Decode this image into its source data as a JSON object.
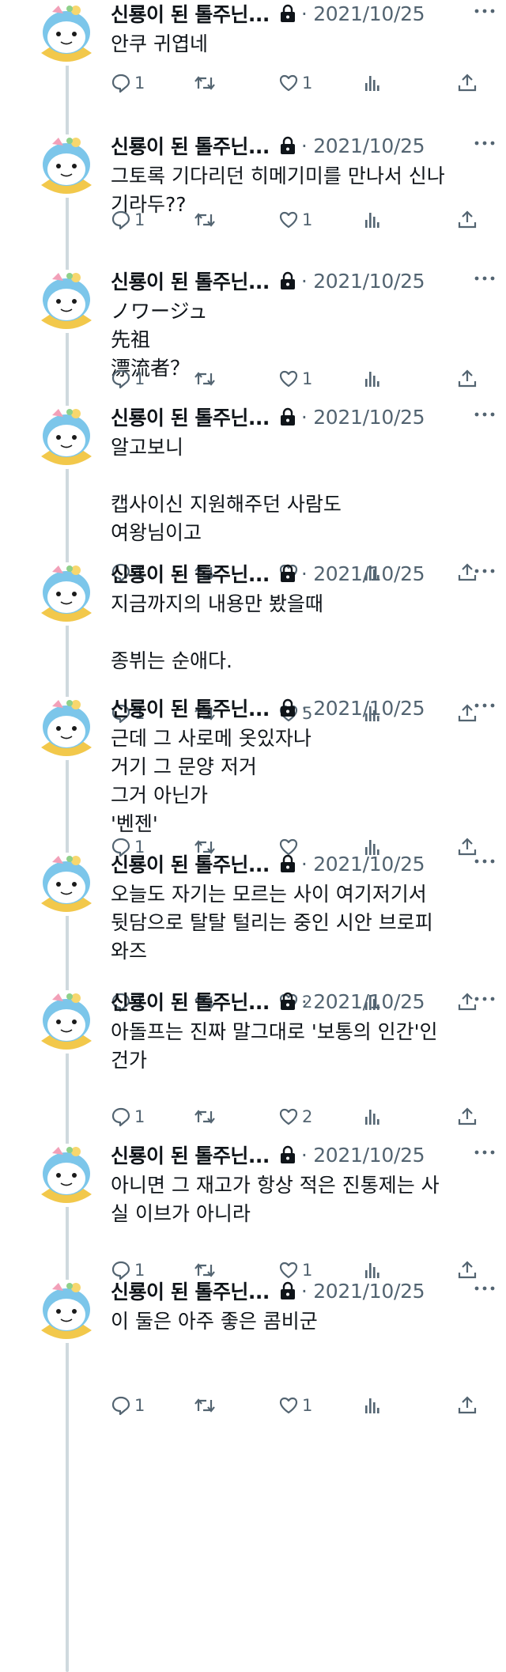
{
  "tweets": [
    {
      "name": "신룡이 된 톨주닌...",
      "date": "· 2021/10/25",
      "text": "안쿠 귀엽네",
      "reply": "1",
      "like": "1"
    },
    {
      "name": "신룡이 된 톨주닌...",
      "date": "· 2021/10/25",
      "text": "그토록 기다리던 히메기미를 만나서 신나\n기라두??",
      "reply": "1",
      "like": "1"
    },
    {
      "name": "신룡이 된 톨주닌...",
      "date": "· 2021/10/25",
      "text": "ノワージュ\n先祖\n漂流者？",
      "reply": "1",
      "like": "1"
    },
    {
      "name": "신룡이 된 톨주닌...",
      "date": "· 2021/10/25",
      "text": "알고보니\n\n캡사이신 지원해주던 사람도\n여왕님이고",
      "reply": "1",
      "like": ""
    },
    {
      "name": "신룡이 된 톨주닌...",
      "date": "· 2021/10/25",
      "text": "지금까지의 내용만 봤을때\n\n종뷔는 순애다.",
      "reply": "1",
      "like": "5"
    },
    {
      "name": "신룡이 된 톨주닌...",
      "date": "· 2021/10/25",
      "text": "근데 그 사로메 옷있자나\n거기 그 문양 저거\n그거 아닌가\n'벤젠'",
      "reply": "1",
      "like": ""
    },
    {
      "name": "신룡이 된 톨주닌...",
      "date": "· 2021/10/25",
      "text": "오늘도 자기는 모르는 사이 여기저기서\n뒷담으로 탈탈 털리는 중인 시안 브로피\n와즈",
      "reply": "1",
      "like": "2"
    },
    {
      "name": "신룡이 된 톨주닌...",
      "date": "· 2021/10/25",
      "text": "아돌프는 진짜 말그대로 '보통의 인간'인\n건가",
      "reply": "1",
      "like": "2"
    },
    {
      "name": "신룡이 된 톨주닌...",
      "date": "· 2021/10/25",
      "text": "아니면 그 재고가 항상 적은 진통제는 사\n실 이브가 아니라",
      "reply": "1",
      "like": "1"
    },
    {
      "name": "신룡이 된 톨주닌...",
      "date": "· 2021/10/25",
      "text": "이 둘은 아주 좋은 콤비군",
      "reply": "1",
      "like": "1"
    }
  ],
  "icons": {
    "avatar": "blue-bird-mascot-avatar",
    "lock": "lock-icon",
    "more": "more-icon",
    "reply": "reply-icon",
    "retweet": "retweet-icon",
    "like": "heart-icon",
    "views": "views-icon",
    "share": "share-icon"
  },
  "colors": {
    "text": "#0f1419",
    "muted": "#536471",
    "thread_line": "#cfd9de",
    "avatar_blue": "#7cc6ea",
    "avatar_scarf": "#f2c84b"
  }
}
